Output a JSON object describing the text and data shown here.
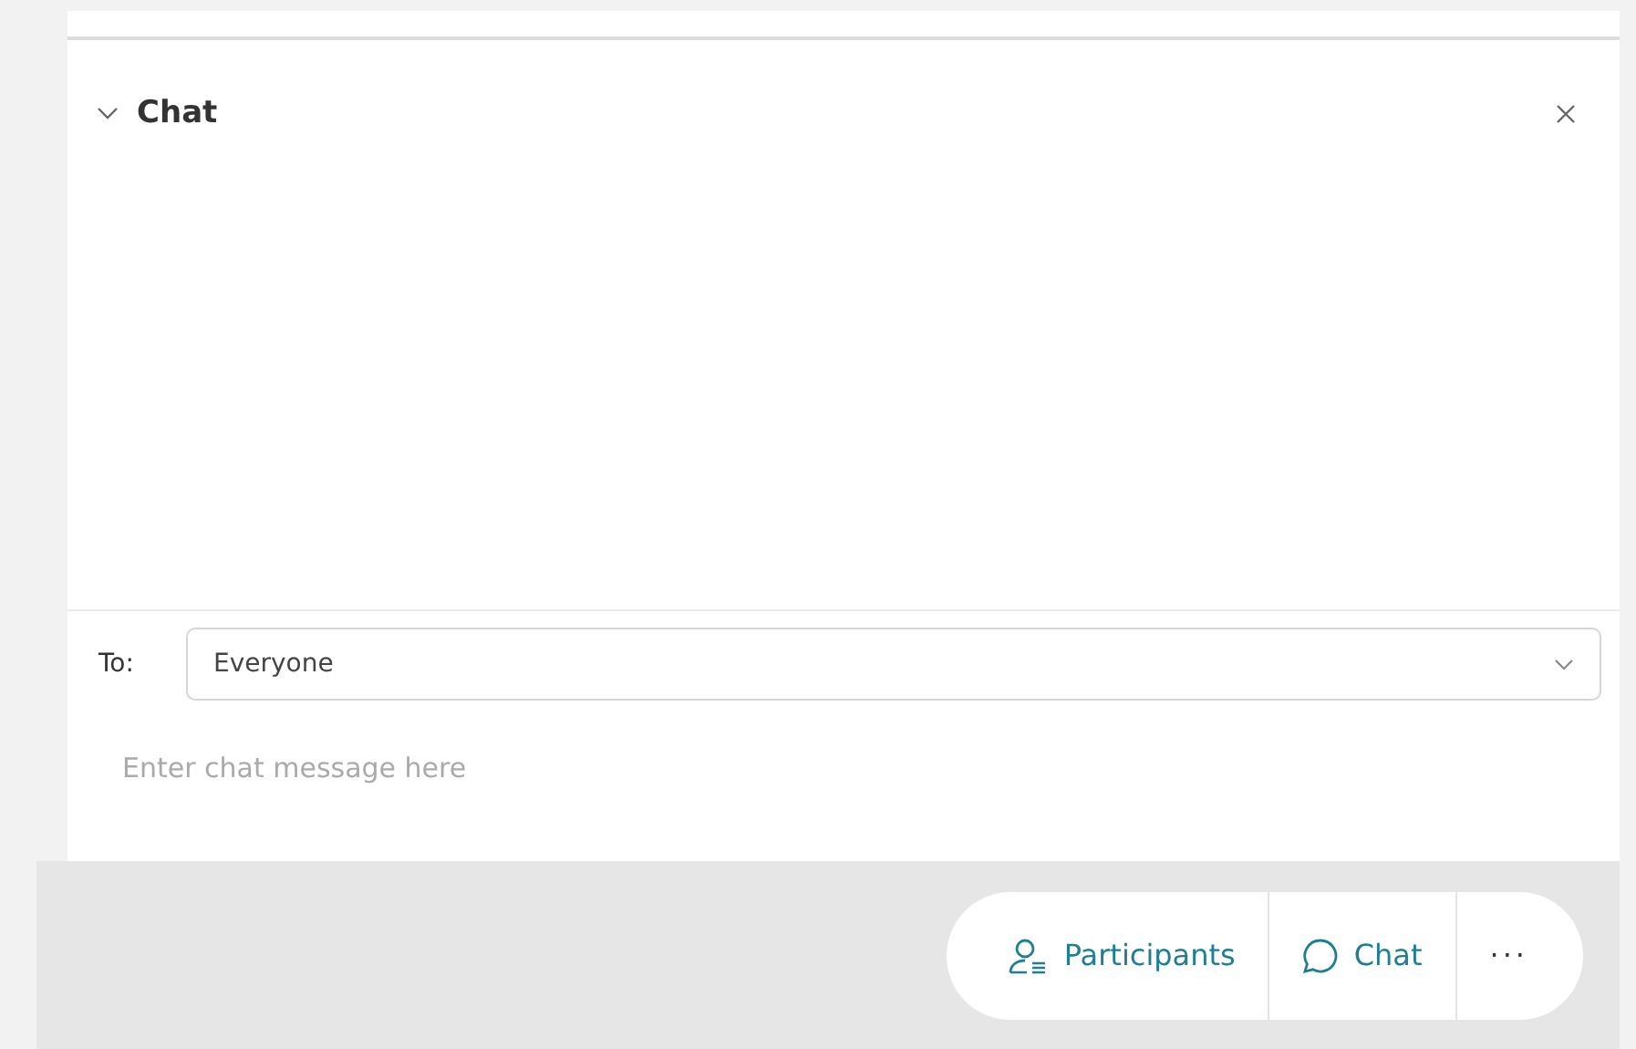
{
  "chat_panel": {
    "title": "Chat",
    "expanded": true,
    "to_label": "To:",
    "recipient": "Everyone",
    "message_placeholder": "Enter chat message here"
  },
  "toolbar": [
    {
      "kind": "participants",
      "label": "Participants"
    },
    {
      "kind": "chat",
      "label": "Chat"
    },
    {
      "kind": "more",
      "label": "···"
    }
  ]
}
